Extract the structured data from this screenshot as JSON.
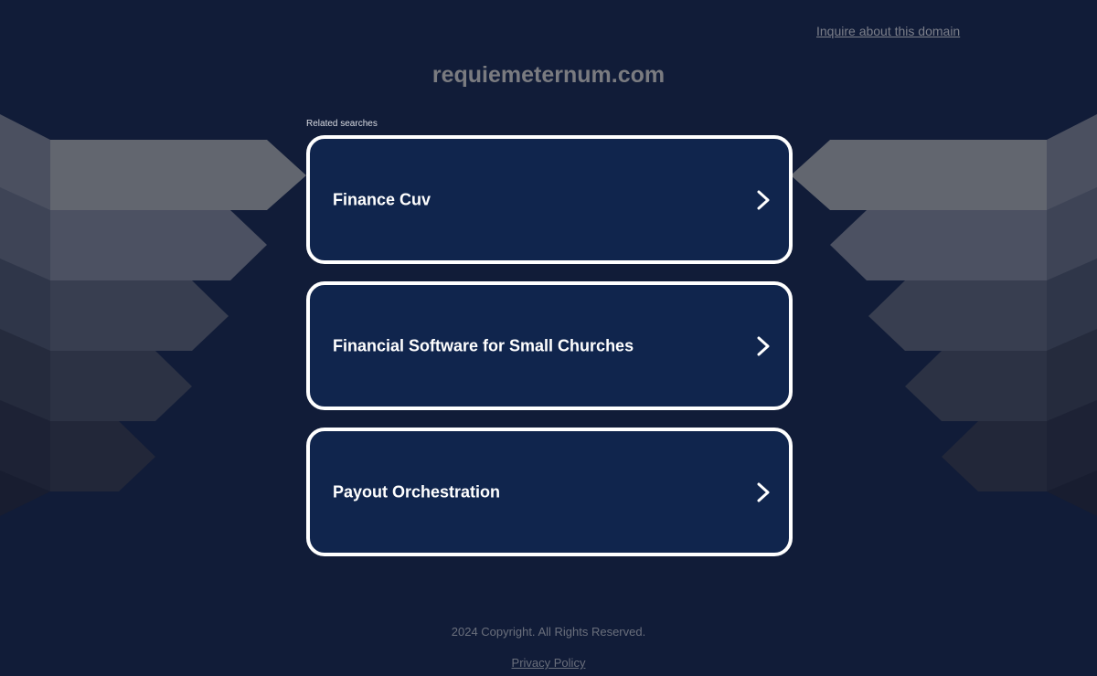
{
  "header": {
    "inquire_link": "Inquire about this domain",
    "domain": "requiemeternum.com"
  },
  "related": {
    "label": "Related searches",
    "items": [
      {
        "label": "Finance Cuv",
        "icon": "chevron-right-icon"
      },
      {
        "label": "Financial Software for Small Churches",
        "icon": "chevron-right-icon"
      },
      {
        "label": "Payout Orchestration",
        "icon": "chevron-right-icon"
      }
    ]
  },
  "footer": {
    "copyright": "2024 Copyright. All Rights Reserved.",
    "privacy": "Privacy Policy"
  },
  "colors": {
    "background": "#111c38",
    "card_background": "#10254d",
    "card_border": "#ffffff",
    "muted_text": "#7c7f8a"
  }
}
